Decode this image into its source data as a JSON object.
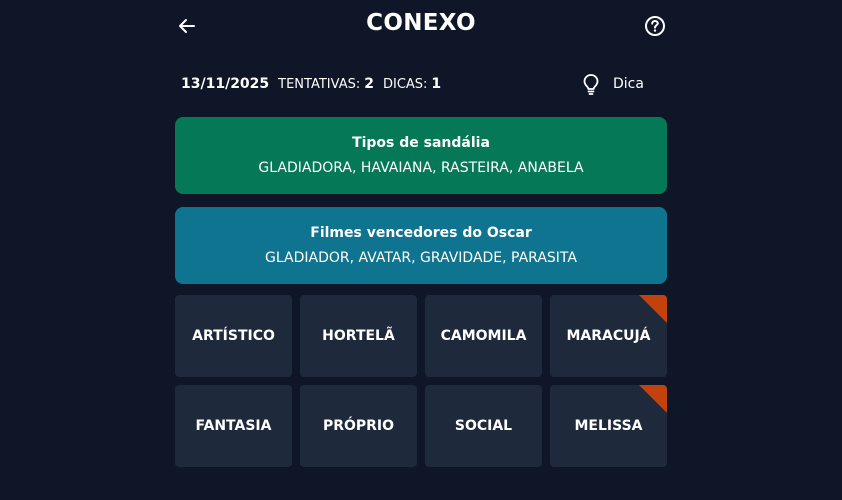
{
  "header": {
    "title": "CONEXO"
  },
  "status": {
    "date": "13/11/2025",
    "attempts_label": "TENTATIVAS:",
    "attempts_value": "2",
    "hints_label": "DICAS:",
    "hints_value": "1",
    "hint_button_label": "Dica"
  },
  "groups": [
    {
      "name": "Tipos de sandália",
      "words": "GLADIADORA, HAVAIANA, RASTEIRA, ANABELA",
      "color": "#047857"
    },
    {
      "name": "Filmes vencedores do Oscar",
      "words": "GLADIADOR, AVATAR, GRAVIDADE, PARASITA",
      "color": "#0e7490"
    }
  ],
  "tiles": [
    {
      "word": "ARTÍSTICO",
      "hinted": false
    },
    {
      "word": "HORTELÃ",
      "hinted": false
    },
    {
      "word": "CAMOMILA",
      "hinted": false
    },
    {
      "word": "MARACUJÁ",
      "hinted": true
    },
    {
      "word": "FANTASIA",
      "hinted": false
    },
    {
      "word": "PRÓPRIO",
      "hinted": false
    },
    {
      "word": "SOCIAL",
      "hinted": false
    },
    {
      "word": "MELISSA",
      "hinted": true
    }
  ],
  "colors": {
    "background": "#0e1628",
    "tile": "#1e293b",
    "hint_corner": "#c2410c"
  }
}
